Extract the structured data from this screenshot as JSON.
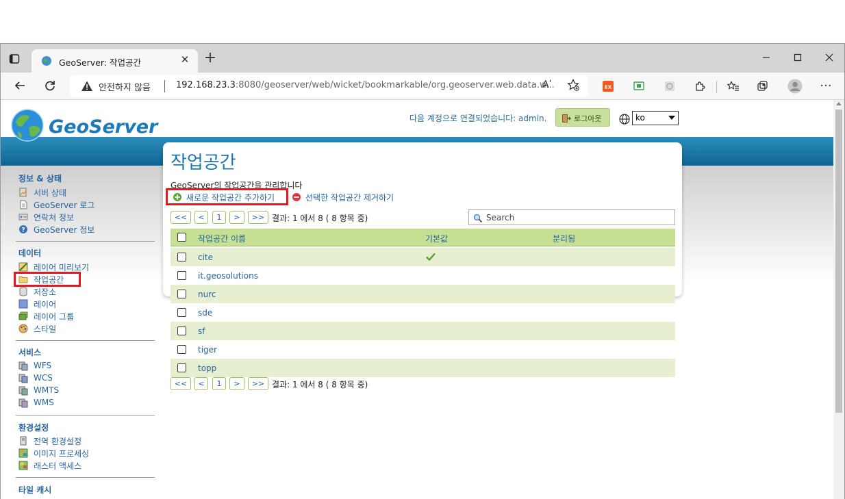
{
  "browser": {
    "tab_title": "GeoServer: 작업공간",
    "tab_close": "✕",
    "new_tab": "+",
    "insecure_label": "안전하지 않음",
    "url_host": "192.168.23.3",
    "url_rest": ":8080/geoserver/web/wicket/bookmarkable/org.geoserver.web.data.w...",
    "read_aloud": "Aʹ",
    "more": "···"
  },
  "header": {
    "logo_text": "GeoServer",
    "login_text": "다음 계정으로 연결되었습니다: admin.",
    "logout_label": "로그아웃",
    "language": "ko"
  },
  "sidebar": {
    "sections": [
      {
        "title": "정보 & 상태",
        "items": [
          "서버 상태",
          "GeoServer 로그",
          "연락처 정보",
          "GeoServer 정보"
        ]
      },
      {
        "title": "데이터",
        "items": [
          "레이어 미리보기",
          "작업공간",
          "저장소",
          "레이어",
          "레이어 그룹",
          "스타일"
        ]
      },
      {
        "title": "서비스",
        "items": [
          "WFS",
          "WCS",
          "WMTS",
          "WMS"
        ]
      },
      {
        "title": "환경설정",
        "items": [
          "전역 환경설정",
          "이미지 프로세싱",
          "래스터 액세스"
        ]
      },
      {
        "title": "타일 캐시",
        "items": []
      }
    ]
  },
  "main": {
    "title": "작업공간",
    "description": "GeoServer의 작업공간을 관리합니다",
    "add_label": "새로운 작업공간 추가하기",
    "remove_label": "선택한 작업공간 제거하기",
    "pager": {
      "first": "<<",
      "prev": "<",
      "page": "1",
      "next": ">",
      "last": ">>",
      "result": "결과: 1 에서 8 ( 8 항목 중)"
    },
    "search_placeholder": "Search",
    "columns": [
      "작업공간 이름",
      "기본값",
      "분리됨"
    ],
    "rows": [
      {
        "name": "cite",
        "default": true
      },
      {
        "name": "it.geosolutions",
        "default": false
      },
      {
        "name": "nurc",
        "default": false
      },
      {
        "name": "sde",
        "default": false
      },
      {
        "name": "sf",
        "default": false
      },
      {
        "name": "tiger",
        "default": false
      },
      {
        "name": "topp",
        "default": false
      }
    ]
  },
  "colors": {
    "accent_blue": "#1c7ab2",
    "header_green": "#c5df93",
    "row_green": "#e6f0d1",
    "highlight_red": "#e01b24"
  }
}
